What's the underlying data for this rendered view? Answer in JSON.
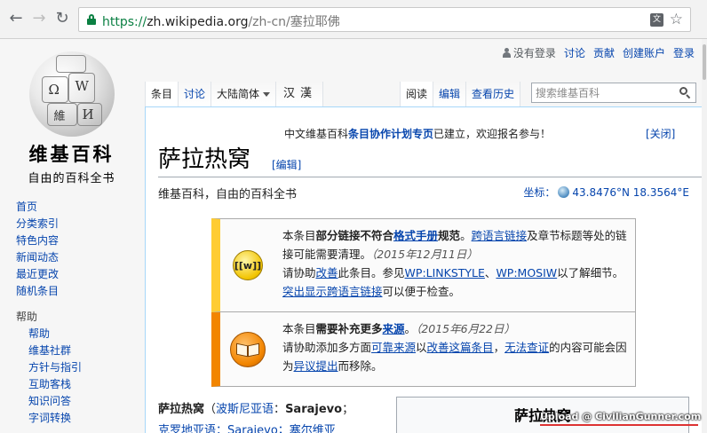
{
  "browser": {
    "url_scheme": "https://",
    "url_host": "zh.wikipedia.org",
    "url_path": "/zh-cn/塞拉耶佛",
    "translate_icon": "translate-icon",
    "star_icon": "star-icon"
  },
  "logo": {
    "title": "维基百科",
    "subtitle": "自由的百科全书",
    "glyphs": [
      "Ω",
      "W",
      "維",
      "И"
    ]
  },
  "sidebar": {
    "main": [
      "首页",
      "分类索引",
      "特色内容",
      "新闻动态",
      "最近更改",
      "随机条目"
    ],
    "help_heading": "帮助",
    "help": [
      "帮助",
      "维基社群",
      "方针与指引",
      "互助客栈",
      "知识问答",
      "字词转换"
    ]
  },
  "personal": {
    "not_logged_in": "没有登录",
    "talk": "讨论",
    "contributions": "贡献",
    "create_account": "创建账户",
    "login": "登录"
  },
  "tabs": {
    "article": "条目",
    "talk": "讨论",
    "variant": "大陆简体",
    "hanzi": "汉漢",
    "read": "阅读",
    "edit": "编辑",
    "history": "查看历史"
  },
  "search": {
    "placeholder": "搜索维基百科"
  },
  "sitenotice": {
    "prefix": "中文维基百科",
    "link": "条目协作计划专页",
    "suffix": "已建立，欢迎报名参与！",
    "close": "[关闭]"
  },
  "article": {
    "title": "萨拉热窝",
    "edit": "[编辑]",
    "tagline": "维基百科，自由的百科全书",
    "coords_label": "坐标：",
    "coords_value": "43.8476°N 18.3564°E",
    "lead_name": "萨拉热窝",
    "lead_paren": "（",
    "lead_lang": "波斯尼亚语",
    "lead_colon": "：",
    "lead_native": "Sarajevo",
    "lead_semicolon": "；",
    "lead_line2": "克罗地亚语：Sarajevo；塞尔维亚",
    "infobox_title": "萨拉热窝"
  },
  "ambox_style": {
    "p1_a": "本条目",
    "p1_b": "部分链接不符合",
    "p1_link": "格式手册",
    "p1_c": "规范",
    "p1_d": "。",
    "p1_link2": "跨语言链接",
    "p1_e": "及章节标题等处的链接可能需要清理。",
    "p1_date": "（2015年12月11日）",
    "p2_a": "请协助",
    "p2_link": "改善",
    "p2_b": "此条目。参见",
    "p2_link2": "WP:LINKSTYLE",
    "p2_c": "、",
    "p2_link3": "WP:MOSIW",
    "p2_d": "以了解细节。",
    "p2_link4": "突出显示跨语言链接",
    "p2_e": "可以便于检查。"
  },
  "ambox_content": {
    "p1_a": "本条目",
    "p1_b": "需要补充更多",
    "p1_link": "来源",
    "p1_c": "。",
    "p1_date": "（2015年6月22日）",
    "p2_a": "请协助添加多方面",
    "p2_link": "可靠来源",
    "p2_b": "以",
    "p2_link2": "改善这篇条目",
    "p2_c": "，",
    "p2_link3": "无法查证",
    "p2_d": "的内容可能会因为",
    "p2_link4": "异议提出",
    "p2_e": "而移除。"
  },
  "watermark": "Upload @ CivilianGunner.com"
}
